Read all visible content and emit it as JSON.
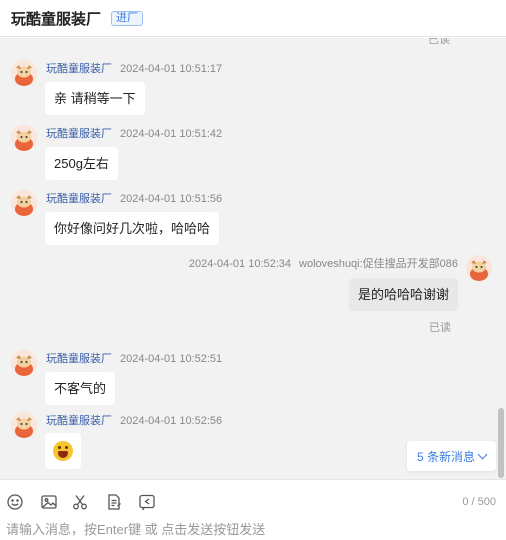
{
  "header": {
    "title": "玩酷童服装厂",
    "badge": "进厂"
  },
  "chat": {
    "top_read_label": "已读",
    "messages": [
      {
        "side": "left",
        "name": "玩酷童服装厂",
        "time": "2024-04-01 10:51:17",
        "text": "亲 请稍等一下"
      },
      {
        "side": "left",
        "name": "玩酷童服装厂",
        "time": "2024-04-01 10:51:42",
        "text": "250g左右"
      },
      {
        "side": "left",
        "name": "玩酷童服装厂",
        "time": "2024-04-01 10:51:56",
        "text": "你好像问好几次啦，哈哈哈"
      },
      {
        "side": "right",
        "name": "woloveshuqi:促佳搜品开发部086",
        "time": "2024-04-01 10:52:34",
        "text": "是的哈哈哈谢谢",
        "status": "已读"
      },
      {
        "side": "left",
        "name": "玩酷童服装厂",
        "time": "2024-04-01 10:52:51",
        "text": "不客气的"
      },
      {
        "side": "left",
        "name": "玩酷童服装厂",
        "time": "2024-04-01 10:52:56",
        "emoji": "laughing-face-emoji"
      }
    ],
    "new_messages_label": "5 条新消息"
  },
  "toolbar": {
    "icons": [
      "emoji-icon",
      "image-icon",
      "scissors-icon",
      "document-icon",
      "history-icon"
    ],
    "counter": "0 / 500"
  },
  "input": {
    "placeholder": "请输入消息，按Enter键 或 点击发送按钮发送"
  },
  "colors": {
    "name_blue": "#3a5fa8",
    "accent_blue": "#3b7be0",
    "chat_bg": "#f2f2f2",
    "my_bubble": "#e8e8e8"
  }
}
